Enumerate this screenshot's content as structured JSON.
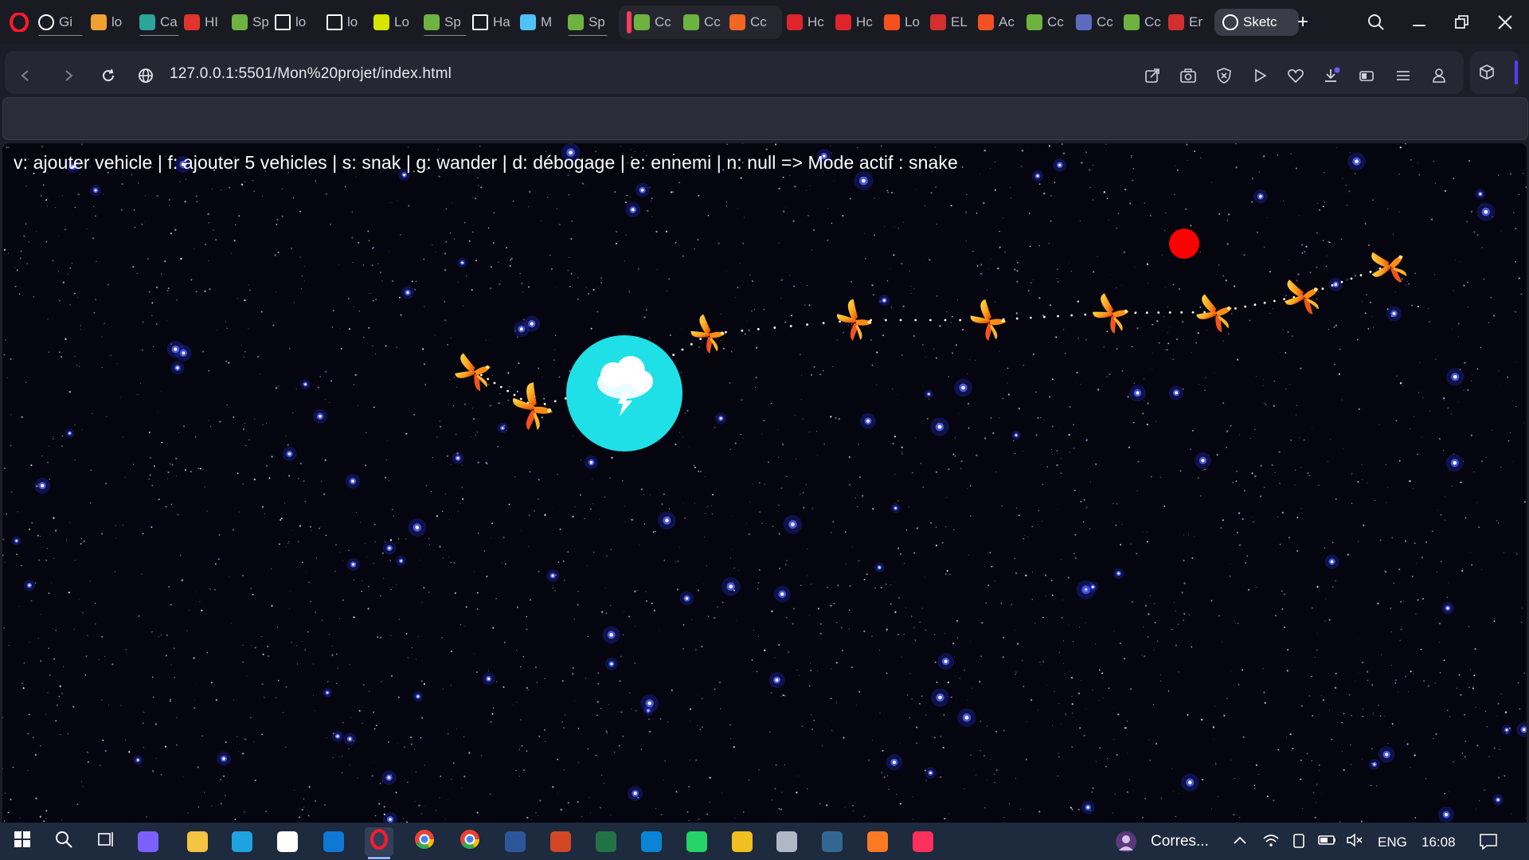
{
  "browser": {
    "tabs": [
      {
        "label": "Gi",
        "icon": "github-icon",
        "color": "#ffffff"
      },
      {
        "label": "lo",
        "icon": "cone-icon",
        "color": "#f0a030"
      },
      {
        "label": "Ca",
        "icon": "gec-icon",
        "color": "#2aa59a"
      },
      {
        "label": "HI",
        "icon": "m-logo-icon",
        "color": "#e0342c"
      },
      {
        "label": "Sp",
        "icon": "spring-leaf-icon",
        "color": "#6db33f"
      },
      {
        "label": "lo",
        "icon": "document-icon",
        "color": "#ffffff"
      },
      {
        "label": "lo",
        "icon": "document-icon",
        "color": "#ffffff"
      },
      {
        "label": "Lo",
        "icon": "amos-icon",
        "color": "#d6e400"
      },
      {
        "label": "Sp",
        "icon": "spring-leaf-icon",
        "color": "#6db33f"
      },
      {
        "label": "Ha",
        "icon": "document-icon",
        "color": "#ffffff"
      },
      {
        "label": "M",
        "icon": "flutter-icon",
        "color": "#4fc3f7"
      },
      {
        "label": "Sp",
        "icon": "spring-leaf-icon",
        "color": "#6db33f"
      },
      {
        "label": "Cc",
        "icon": "spring-boot-icon",
        "color": "#6db33f"
      },
      {
        "label": "Cc",
        "icon": "spring-boot-icon",
        "color": "#6db33f"
      },
      {
        "label": "Cc",
        "icon": "c-logo-icon",
        "color": "#f26522"
      },
      {
        "label": "Hc",
        "icon": "bookmark-red-icon",
        "color": "#e0242c"
      },
      {
        "label": "Hc",
        "icon": "bookmark-red-icon",
        "color": "#e0242c"
      },
      {
        "label": "Lo",
        "icon": "n-logo-icon",
        "color": "#f4511e"
      },
      {
        "label": "EL",
        "icon": "red-logo-icon",
        "color": "#d32f2f"
      },
      {
        "label": "Ac",
        "icon": "microsoft-icon",
        "color": "#f25022"
      },
      {
        "label": "Cc",
        "icon": "spring-boot-icon",
        "color": "#6db33f"
      },
      {
        "label": "Cc",
        "icon": "c-circle-icon",
        "color": "#5c6bc0"
      },
      {
        "label": "Cc",
        "icon": "spring-boot-icon",
        "color": "#6db33f"
      },
      {
        "label": "Er",
        "icon": "red-logo-icon",
        "color": "#d32f2f"
      },
      {
        "label": "Sketc",
        "icon": "globe-icon",
        "color": "#ffffff"
      }
    ],
    "new_tab": "+",
    "url": "127.0.0.1:5501/Mon%20projet/index.html"
  },
  "page": {
    "hud_text": "v: ajouter vehicle | f: ajouter 5 vehicles | s: snak | g: wander | d: débogage | e: ennemi | n: null  => Mode actif : snake",
    "target_color": "#ff0000",
    "planet_color": "#1fe0e6",
    "background_color": "#05050f"
  },
  "taskbar": {
    "apps": [
      "start-icon",
      "search-icon",
      "task-view-icon",
      "copilot-icon",
      "file-explorer-icon",
      "edge-icon",
      "store-icon",
      "outlook-icon",
      "opera-icon",
      "chrome-icon",
      "chrome-profile-icon",
      "word-icon",
      "powerpoint-icon",
      "excel-icon",
      "vscode-icon",
      "whatsapp-icon",
      "app-icon",
      "vpn-icon",
      "postgres-icon",
      "xampp-icon",
      "intellij-icon"
    ],
    "active_app": "opera-icon",
    "notification_text": "Corres...",
    "language": "ENG",
    "time": "16:08"
  }
}
